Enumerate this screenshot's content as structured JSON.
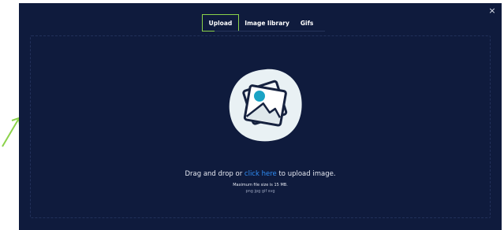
{
  "tabs": [
    {
      "label": "Upload",
      "active": true
    },
    {
      "label": "Image library",
      "active": false
    },
    {
      "label": "Gifs",
      "active": false
    }
  ],
  "close_label": "×",
  "dropzone": {
    "prefix": "Drag and drop or ",
    "link_text": "click here",
    "suffix": " to upload image.",
    "max_size": "Maximum file size is 15 MB.",
    "formats": "png jpg gif svg"
  },
  "colors": {
    "modal_bg": "#0f1b3d",
    "active_tab_outline": "#8bd24a",
    "link": "#2f8df5",
    "annotation_arrow": "#8bd24a",
    "blob": "#e9f1f4",
    "sun": "#1aa3c4"
  },
  "icons": {
    "close": "close-icon",
    "upload_illustration": "image-placeholder-icon",
    "arrow": "annotation-arrow"
  }
}
